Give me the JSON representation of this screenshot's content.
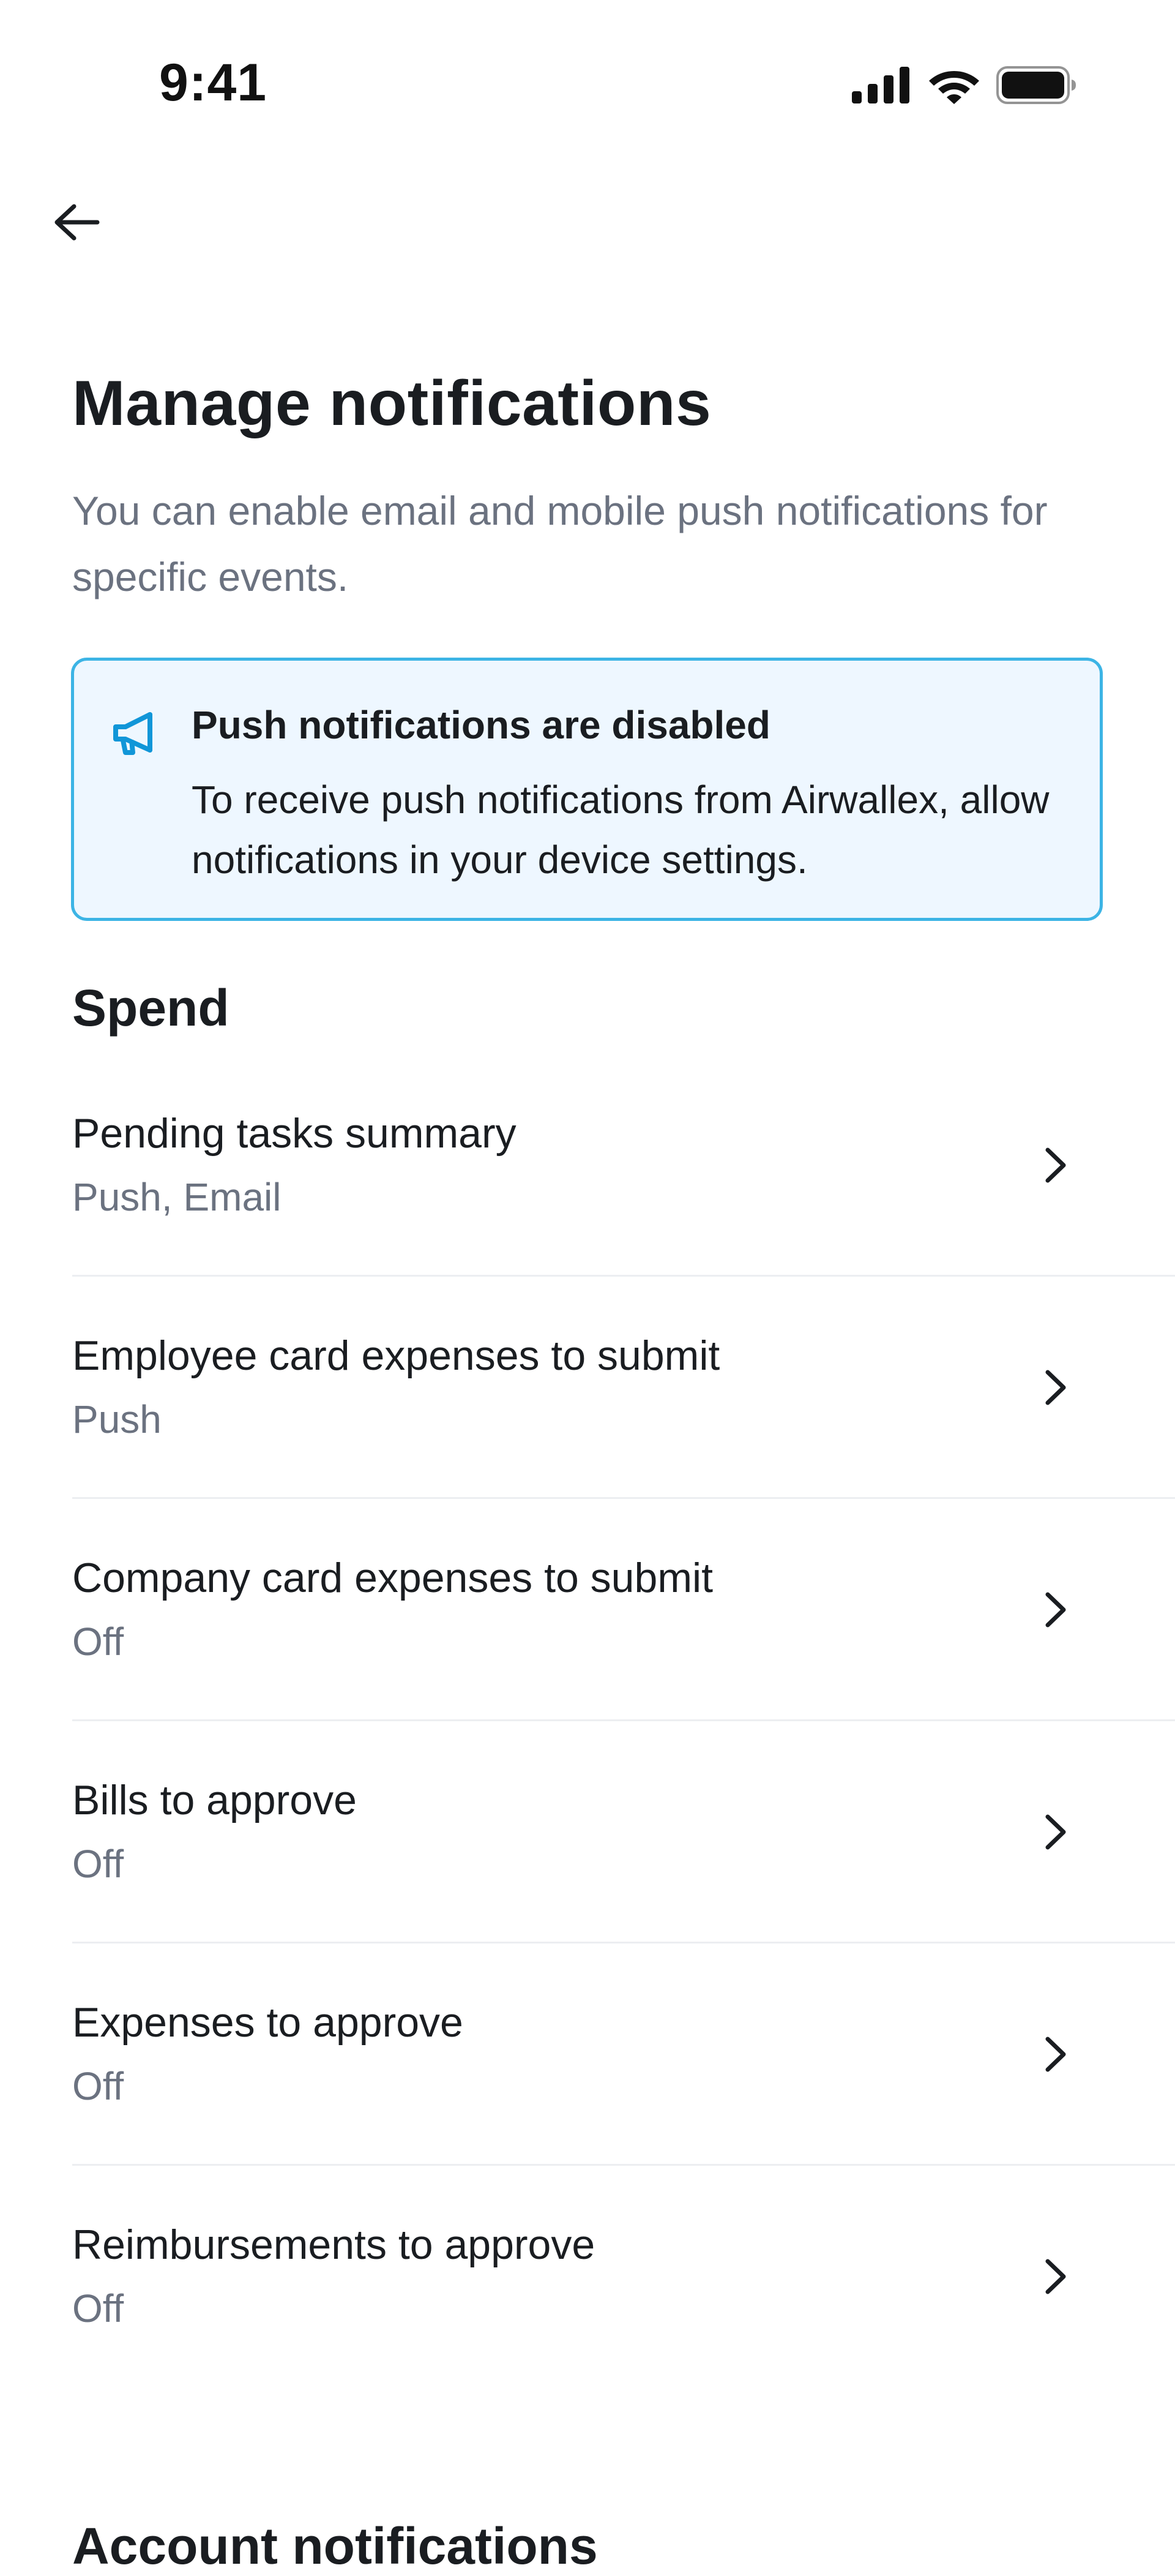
{
  "status_bar": {
    "time": "9:41",
    "icons": [
      "cellular-signal-icon",
      "wifi-icon",
      "battery-icon"
    ]
  },
  "header": {
    "back_icon": "arrow-left-icon"
  },
  "page": {
    "title": "Manage notifications",
    "description": "You can enable email and mobile push notifications for specific events."
  },
  "banner": {
    "icon": "megaphone-icon",
    "title": "Push notifications are disabled",
    "text": "To receive push notifications from Airwallex, allow notifications in your device settings.",
    "border_color": "#3cb4e5",
    "background_color": "#eef7ff",
    "icon_color": "#1196d8"
  },
  "sections": [
    {
      "heading": "Spend",
      "items": [
        {
          "title": "Pending tasks summary",
          "subtitle": "Push, Email"
        },
        {
          "title": "Employee card expenses to submit",
          "subtitle": "Push"
        },
        {
          "title": "Company card expenses to submit",
          "subtitle": "Off"
        },
        {
          "title": "Bills to approve",
          "subtitle": "Off"
        },
        {
          "title": "Expenses to approve",
          "subtitle": "Off"
        },
        {
          "title": "Reimbursements to approve",
          "subtitle": "Off"
        }
      ]
    },
    {
      "heading": "Account notifications"
    }
  ]
}
